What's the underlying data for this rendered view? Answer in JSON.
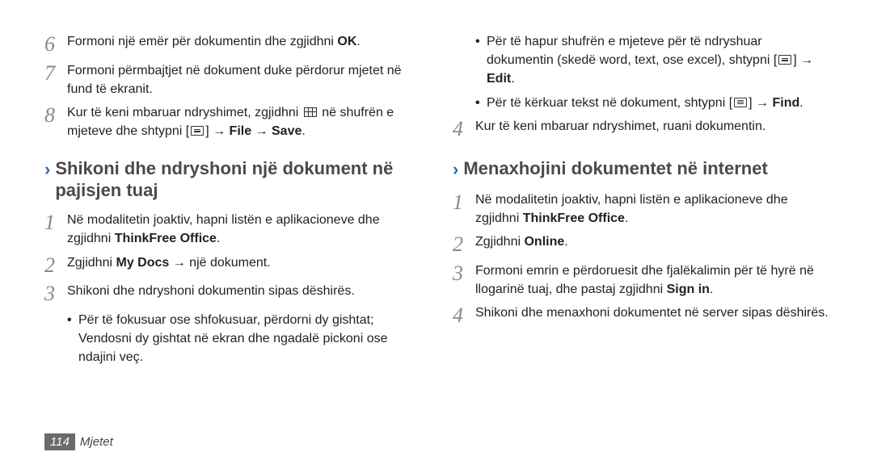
{
  "left": {
    "steps_top": [
      {
        "num": "6",
        "parts": [
          {
            "t": "Formoni një emër për dokumentin dhe zgjidhni "
          },
          {
            "t": "OK",
            "b": true
          },
          {
            "t": "."
          }
        ]
      },
      {
        "num": "7",
        "parts": [
          {
            "t": "Formoni përmbajtjet në dokument duke përdorur mjetet në fund të ekranit."
          }
        ]
      },
      {
        "num": "8",
        "parts": [
          {
            "t": "Kur të keni mbaruar ndryshimet, zgjidhni "
          },
          {
            "icon": "grid"
          },
          {
            "t": " në shufrën e mjeteve dhe shtypni ["
          },
          {
            "icon": "menu"
          },
          {
            "t": "] "
          },
          {
            "t": "→ File → Save",
            "b": true
          },
          {
            "t": "."
          }
        ]
      }
    ],
    "heading": "Shikoni dhe ndryshoni një dokument në pajisjen tuaj",
    "steps_h": [
      {
        "num": "1",
        "parts": [
          {
            "t": "Në modalitetin joaktiv, hapni listën e aplikacioneve dhe zgjidhni "
          },
          {
            "t": "ThinkFree Office",
            "b": true
          },
          {
            "t": "."
          }
        ]
      },
      {
        "num": "2",
        "parts": [
          {
            "t": "Zgjidhni "
          },
          {
            "t": "My Docs",
            "b": true
          },
          {
            "t": " → një dokument."
          }
        ]
      },
      {
        "num": "3",
        "parts": [
          {
            "t": "Shikoni dhe ndryshoni dokumentin sipas dëshirës."
          }
        ]
      }
    ],
    "bullets": [
      {
        "parts": [
          {
            "t": "Për të fokusuar ose shfokusuar, përdorni dy gishtat; Vendosni dy gishtat në ekran dhe ngadalë pickoni ose ndajini veç."
          }
        ]
      }
    ]
  },
  "right": {
    "bullets_top": [
      {
        "parts": [
          {
            "t": "Për të hapur shufrën e mjeteve për të ndryshuar dokumentin (skedë word, text, ose excel), shtypni ["
          },
          {
            "icon": "menu"
          },
          {
            "t": "] "
          },
          {
            "t": "→ Edit",
            "b": true
          },
          {
            "t": "."
          }
        ]
      },
      {
        "parts": [
          {
            "t": "Për të kërkuar tekst në dokument, shtypni ["
          },
          {
            "icon": "menu"
          },
          {
            "t": "] → "
          },
          {
            "t": "Find",
            "b": true
          },
          {
            "t": "."
          }
        ]
      }
    ],
    "steps_top": [
      {
        "num": "4",
        "parts": [
          {
            "t": "Kur të keni mbaruar ndryshimet, ruani dokumentin."
          }
        ]
      }
    ],
    "heading": "Menaxhojini dokumentet në internet",
    "steps_h": [
      {
        "num": "1",
        "parts": [
          {
            "t": "Në modalitetin joaktiv, hapni listën e aplikacioneve dhe zgjidhni "
          },
          {
            "t": "ThinkFree Office",
            "b": true
          },
          {
            "t": "."
          }
        ]
      },
      {
        "num": "2",
        "parts": [
          {
            "t": "Zgjidhni "
          },
          {
            "t": "Online",
            "b": true
          },
          {
            "t": "."
          }
        ]
      },
      {
        "num": "3",
        "parts": [
          {
            "t": "Formoni emrin e përdoruesit dhe fjalëkalimin për të hyrë në llogarinë tuaj, dhe pastaj zgjidhni "
          },
          {
            "t": "Sign in",
            "b": true
          },
          {
            "t": "."
          }
        ]
      },
      {
        "num": "4",
        "parts": [
          {
            "t": "Shikoni dhe menaxhoni dokumentet në server sipas dëshirës."
          }
        ]
      }
    ]
  },
  "footer": {
    "page": "114",
    "section": "Mjetet"
  },
  "chevron": "›"
}
